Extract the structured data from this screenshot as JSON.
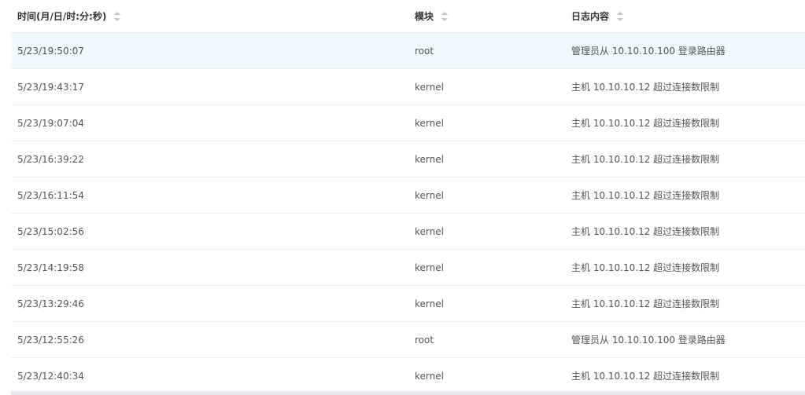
{
  "table": {
    "headers": {
      "time": "时间(月/日/时:分:秒)",
      "module": "模块",
      "content": "日志内容"
    },
    "rows": [
      {
        "time": "5/23/19:50:07",
        "module": "root",
        "content": "管理员从 10.10.10.100 登录路由器",
        "selected": true
      },
      {
        "time": "5/23/19:43:17",
        "module": "kernel",
        "content": "主机 10.10.10.12 超过连接数限制"
      },
      {
        "time": "5/23/19:07:04",
        "module": "kernel",
        "content": "主机 10.10.10.12 超过连接数限制"
      },
      {
        "time": "5/23/16:39:22",
        "module": "kernel",
        "content": "主机 10.10.10.12 超过连接数限制"
      },
      {
        "time": "5/23/16:11:54",
        "module": "kernel",
        "content": "主机 10.10.10.12 超过连接数限制"
      },
      {
        "time": "5/23/15:02:56",
        "module": "kernel",
        "content": "主机 10.10.10.12 超过连接数限制"
      },
      {
        "time": "5/23/14:19:58",
        "module": "kernel",
        "content": "主机 10.10.10.12 超过连接数限制"
      },
      {
        "time": "5/23/13:29:46",
        "module": "kernel",
        "content": "主机 10.10.10.12 超过连接数限制"
      },
      {
        "time": "5/23/12:55:26",
        "module": "root",
        "content": "管理员从 10.10.10.100 登录路由器"
      },
      {
        "time": "5/23/12:40:34",
        "module": "kernel",
        "content": "主机 10.10.10.12 超过连接数限制"
      }
    ]
  },
  "icons": {
    "sort": "sort-icon"
  },
  "colors": {
    "selected_row_bg": "#eefafe",
    "border": "#eaecef",
    "text": "#555555",
    "header_text": "#333333"
  }
}
